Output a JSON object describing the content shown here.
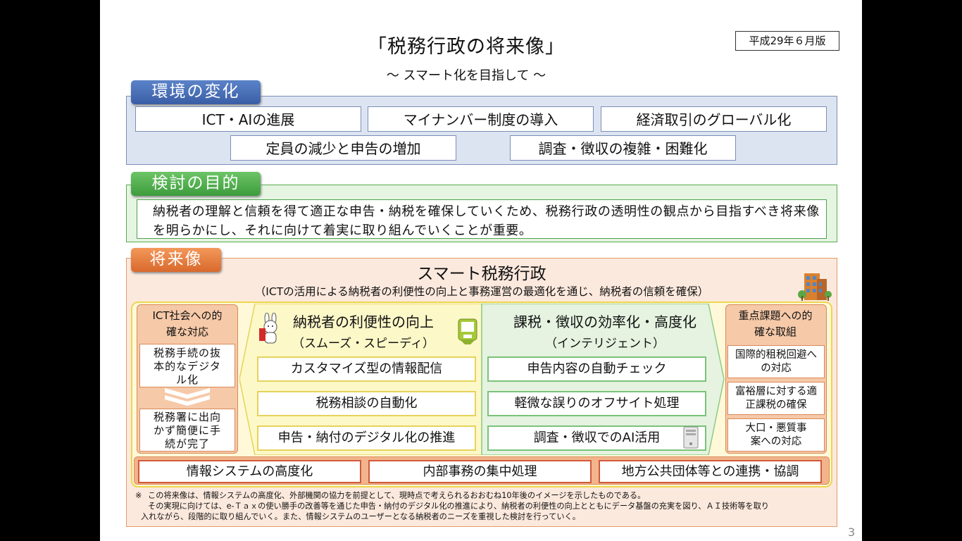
{
  "title": "「税務行政の将来像」",
  "subtitle": "～ スマート化を目指して ～",
  "date_badge": "平成29年６月版",
  "page_number": "3",
  "sections": {
    "environment": {
      "tab": "環境の変化",
      "items": [
        "ICT・AIの進展",
        "マイナンバー制度の導入",
        "経済取引のグローバル化",
        "定員の減少と申告の増加",
        "調査・徴収の複雑・困難化"
      ]
    },
    "purpose": {
      "tab": "検討の目的",
      "text": "納税者の理解と信頼を得て適正な申告・納税を確保していくため、税務行政の透明性の観点から目指すべき将来像を明らかにし、それに向けて着実に取り組んでいくことが重要。"
    },
    "future": {
      "tab": "将来像",
      "heading": "スマート税務行政",
      "subheading": "（ICTの活用による納税者の利便性の向上と事務運営の最適化を通じ、納税者の信頼を確保）",
      "left": {
        "title": "ICT社会への的確な対応",
        "box1": "税務手続の抜本的なデジタル化",
        "box2": "税務署に出向かず簡便に手続が完了"
      },
      "convenience": {
        "title": "納税者の利便性の向上",
        "subtitle": "（スムーズ・スピーディ）",
        "items": [
          "カスタマイズ型の情報配信",
          "税務相談の自動化",
          "申告・納付のデジタル化の推進"
        ]
      },
      "efficiency": {
        "title": "課税・徴収の効率化・高度化",
        "subtitle": "（インテリジェント）",
        "items": [
          "申告内容の自動チェック",
          "軽微な誤りのオフサイト処理",
          "調査・徴収でのAI活用"
        ]
      },
      "right": {
        "title": "重点課題への的確な取組",
        "items": [
          "国際的租税回避への対応",
          "富裕層に対する適正課税の確保",
          "大口・悪質事案への対応"
        ]
      },
      "bottom": [
        "情報システムの高度化",
        "内部事務の集中処理",
        "地方公共団体等との連携・協調"
      ]
    }
  },
  "footnote": {
    "mark": "※",
    "line1": "この将来像は、情報システムの高度化、外部機関の協力を前提として、現時点で考えられるおおむね10年後のイメージを示したものである。",
    "line2": "その実現に向けては、e-Ｔａｘの使い勝手の改善等を通じた申告・納付のデジタル化の推進により、納税者の利便性の向上とともにデータ基盤の充実を図り、ＡＩ技術等を取り",
    "line3": "入れながら、段階的に取り組んでいく。また、情報システムのユーザーとなる納税者のニーズを重視した検討を行っていく。"
  },
  "colors": {
    "env_tab": "#3f65ad",
    "env_bg": "#dde4f1",
    "purpose_tab": "#4eac4e",
    "purpose_bg": "#e6f4e2",
    "future_tab": "#e0793a",
    "future_bg": "#fce9dd",
    "convenience_bg": "#fdf8c8",
    "efficiency_bg": "#e5f3e0"
  }
}
